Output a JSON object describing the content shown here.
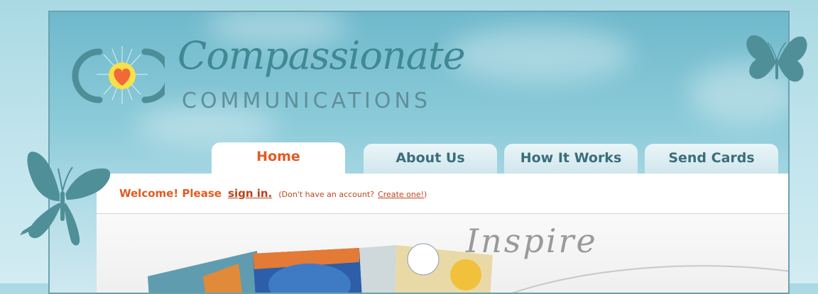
{
  "brand": {
    "name_script": "Compassionate",
    "name_caps": "COMMUNICATIONS",
    "logo_icon": "heart-logo-icon"
  },
  "nav": {
    "tabs": [
      {
        "label": "Home",
        "active": true
      },
      {
        "label": "About Us",
        "active": false
      },
      {
        "label": "How It Works",
        "active": false
      },
      {
        "label": "Send Cards",
        "active": false
      }
    ]
  },
  "welcome": {
    "greeting": "Welcome! Please",
    "signin_link": "sign in.",
    "note_prefix": "(Don't have an account?",
    "create_link": "Create one!",
    "note_suffix": ")"
  },
  "hero": {
    "heading": "Inspire"
  },
  "colors": {
    "accent": "#e55a21",
    "tab_text": "#3b6e7b",
    "brand_teal": "#3f8894",
    "butterfly": "#4f8f98"
  },
  "icons": [
    "butterfly-icon",
    "heart-logo-icon"
  ]
}
